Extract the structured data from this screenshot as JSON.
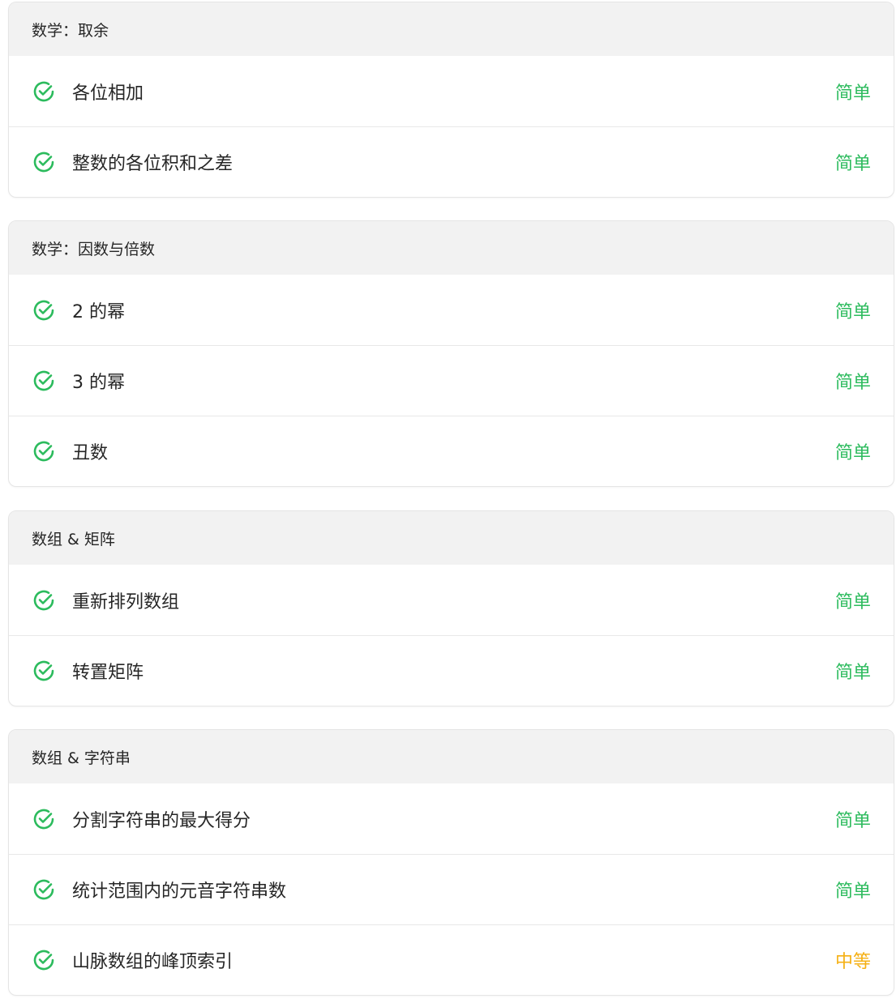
{
  "colors": {
    "easy": "#2cbb5d",
    "medium": "#f5b014",
    "check": "#2cbb5d",
    "header_bg": "#f2f2f2"
  },
  "groups": [
    {
      "title": "数学：取余",
      "problems": [
        {
          "title": "各位相加",
          "difficulty": "简单",
          "level": "easy",
          "solved": true,
          "icon": "check-circle-icon"
        },
        {
          "title": "整数的各位积和之差",
          "difficulty": "简单",
          "level": "easy",
          "solved": true,
          "icon": "check-circle-icon"
        }
      ]
    },
    {
      "title": "数学：因数与倍数",
      "problems": [
        {
          "title": "2 的幂",
          "difficulty": "简单",
          "level": "easy",
          "solved": true,
          "icon": "check-circle-icon"
        },
        {
          "title": "3 的幂",
          "difficulty": "简单",
          "level": "easy",
          "solved": true,
          "icon": "check-circle-icon"
        },
        {
          "title": "丑数",
          "difficulty": "简单",
          "level": "easy",
          "solved": true,
          "icon": "check-circle-icon"
        }
      ]
    },
    {
      "title": "数组 & 矩阵",
      "problems": [
        {
          "title": "重新排列数组",
          "difficulty": "简单",
          "level": "easy",
          "solved": true,
          "icon": "check-circle-icon"
        },
        {
          "title": "转置矩阵",
          "difficulty": "简单",
          "level": "easy",
          "solved": true,
          "icon": "check-circle-icon"
        }
      ]
    },
    {
      "title": "数组 & 字符串",
      "problems": [
        {
          "title": "分割字符串的最大得分",
          "difficulty": "简单",
          "level": "easy",
          "solved": true,
          "icon": "check-circle-icon"
        },
        {
          "title": "统计范围内的元音字符串数",
          "difficulty": "简单",
          "level": "easy",
          "solved": true,
          "icon": "check-circle-icon"
        },
        {
          "title": "山脉数组的峰顶索引",
          "difficulty": "中等",
          "level": "medium",
          "solved": true,
          "icon": "check-circle-icon"
        }
      ]
    }
  ]
}
